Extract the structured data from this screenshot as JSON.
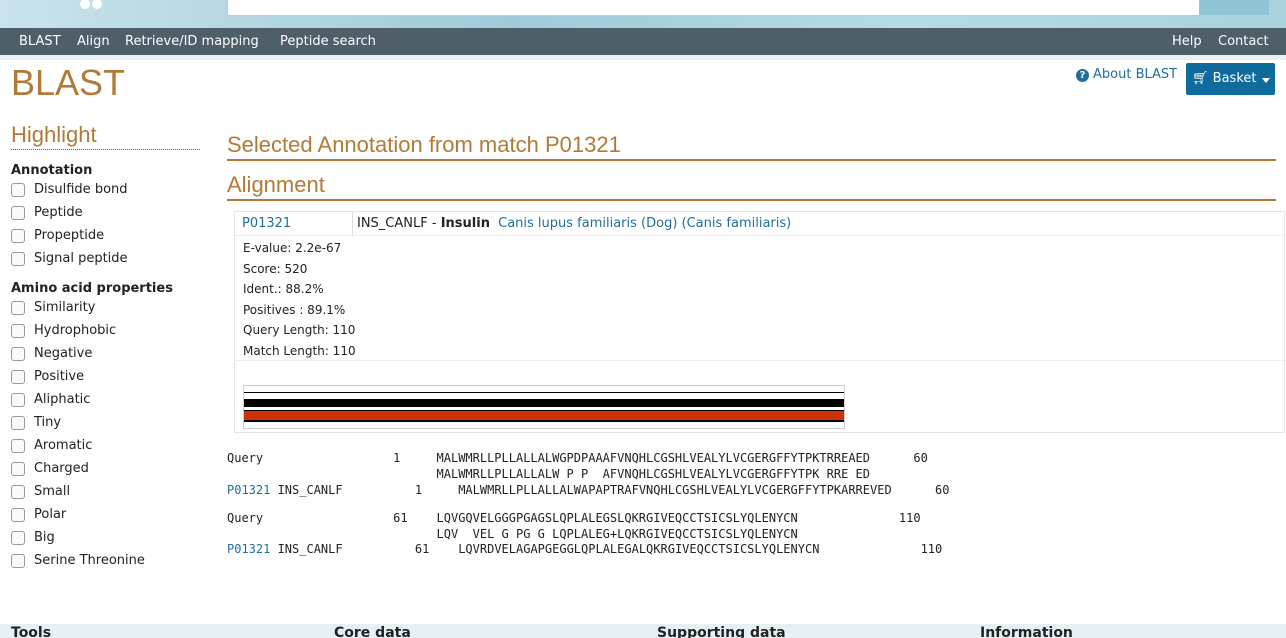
{
  "nav": {
    "left": [
      "BLAST",
      "Align",
      "Retrieve/ID mapping",
      "Peptide search"
    ],
    "right": [
      "Help",
      "Contact"
    ]
  },
  "page_title": "BLAST",
  "about_label": "About BLAST",
  "basket_label": "Basket",
  "sidebar": {
    "title": "Highlight",
    "annotation_heading": "Annotation",
    "annotation_items": [
      "Disulfide bond",
      "Peptide",
      "Propeptide",
      "Signal peptide"
    ],
    "amino_heading": "Amino acid properties",
    "amino_items": [
      "Similarity",
      "Hydrophobic",
      "Negative",
      "Positive",
      "Aliphatic",
      "Tiny",
      "Aromatic",
      "Charged",
      "Small",
      "Polar",
      "Big",
      "Serine Threonine"
    ]
  },
  "main": {
    "selected_heading": "Selected Annotation from match P01321",
    "alignment_heading": "Alignment",
    "match": {
      "accession": "P01321",
      "entry_name": "INS_CANLF",
      "dash": "-",
      "protein": "Insulin",
      "organism": "Canis lupus familiaris (Dog) (Canis familiaris)"
    },
    "stats": [
      "E-value: 2.2e-67",
      "Score: 520",
      "Ident.: 88.2%",
      "Positives : 89.1%",
      "Query Length: 110",
      "Match Length: 110"
    ],
    "alignment_blocks": [
      {
        "query": "Query                  1     MALWMRLLPLLALLALWGPDPAAAFVNQHLCGSHLVEALYLVCGERGFFYTPKTRREAED      60",
        "mid": "                             MALWMRLLPLLALLALW P P  AFVNQHLCGSHLVEALYLVCGERGFFYTPK RRE ED",
        "subject_acc": "P01321",
        "subject_rest": " INS_CANLF          1     MALWMRLLPLLALLALWAPAPTRAFVNQHLCGSHLVEALYLVCGERGFFYTPKARREVED      60"
      },
      {
        "query": "Query                  61    LQVGQVELGGGPGAGSLQPLALEGSLQKRGIVEQCCTSICSLYQLENYCN              110",
        "mid": "                             LQV  VEL G PG G LQPLALEG+LQKRGIVEQCCTSICSLYQLENYCN",
        "subject_acc": "P01321",
        "subject_rest": " INS_CANLF          61    LQVRDVELAGAPGEGGLQPLALEGALQKRGIVEQCCTSICSLYQLENYCN              110"
      }
    ]
  },
  "footer": [
    "Tools",
    "Core data",
    "Supporting data",
    "Information"
  ],
  "colors": {
    "accent": "#b27a39",
    "link": "#1f6f9a",
    "nav_bg": "#4e5f6a",
    "match_bar": "#cc3300"
  }
}
